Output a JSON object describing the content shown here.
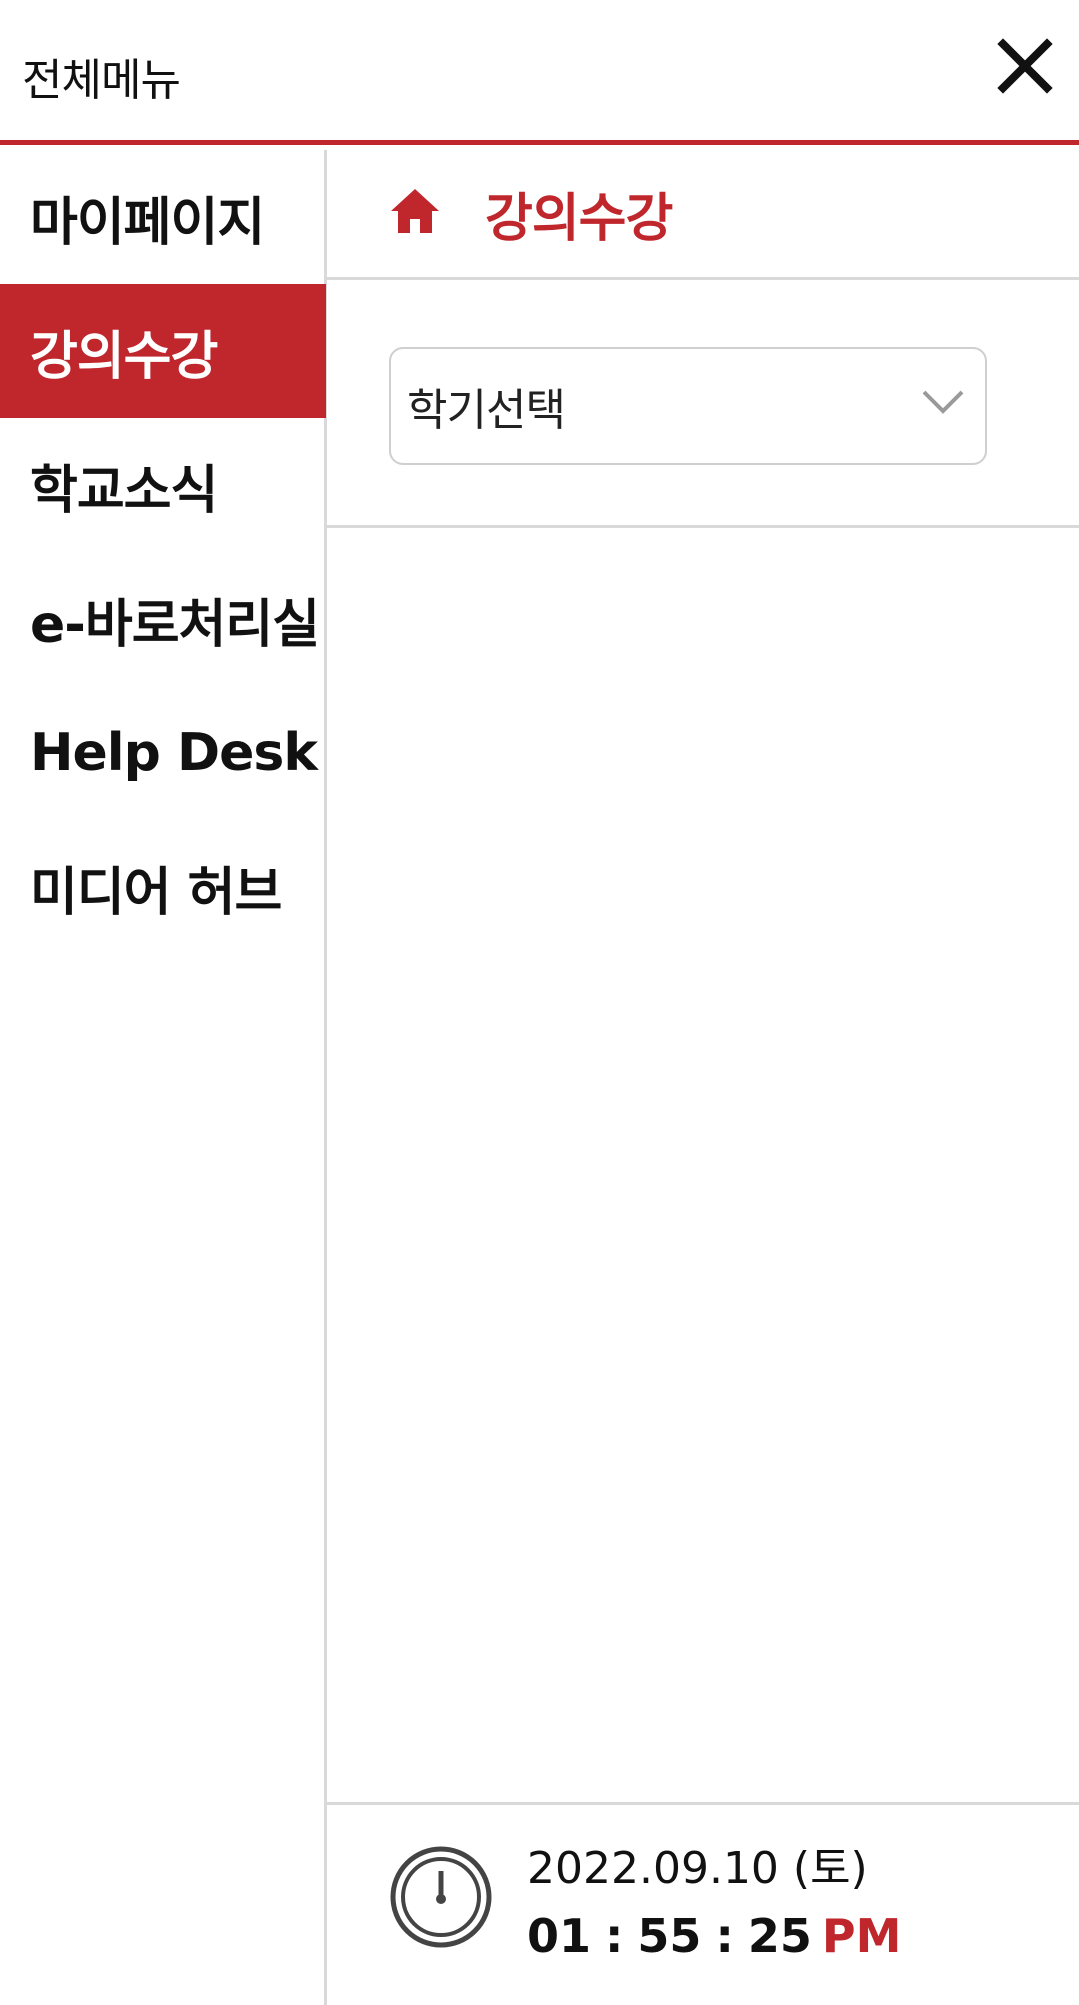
{
  "header": {
    "title": "전체메뉴",
    "close_icon": "close-icon"
  },
  "nav": {
    "items": [
      {
        "label": "마이페이지",
        "active": false
      },
      {
        "label": "강의수강",
        "active": true
      },
      {
        "label": "학교소식",
        "active": false
      },
      {
        "label": "e-바로처리실",
        "active": false
      },
      {
        "label": "Help Desk",
        "active": false
      },
      {
        "label": "미디어 허브",
        "active": false
      }
    ]
  },
  "section": {
    "home_icon": "home-icon",
    "title": "강의수강"
  },
  "semester_select": {
    "value": "학기선택",
    "chevron_icon": "chevron-down-icon"
  },
  "clock": {
    "date": "2022.09.10 (토)",
    "hour": "01",
    "minute": "55",
    "second": "25",
    "separator": ":",
    "ampm": "PM"
  },
  "colors": {
    "accent": "#c0272d",
    "divider": "#d9d9d9"
  }
}
